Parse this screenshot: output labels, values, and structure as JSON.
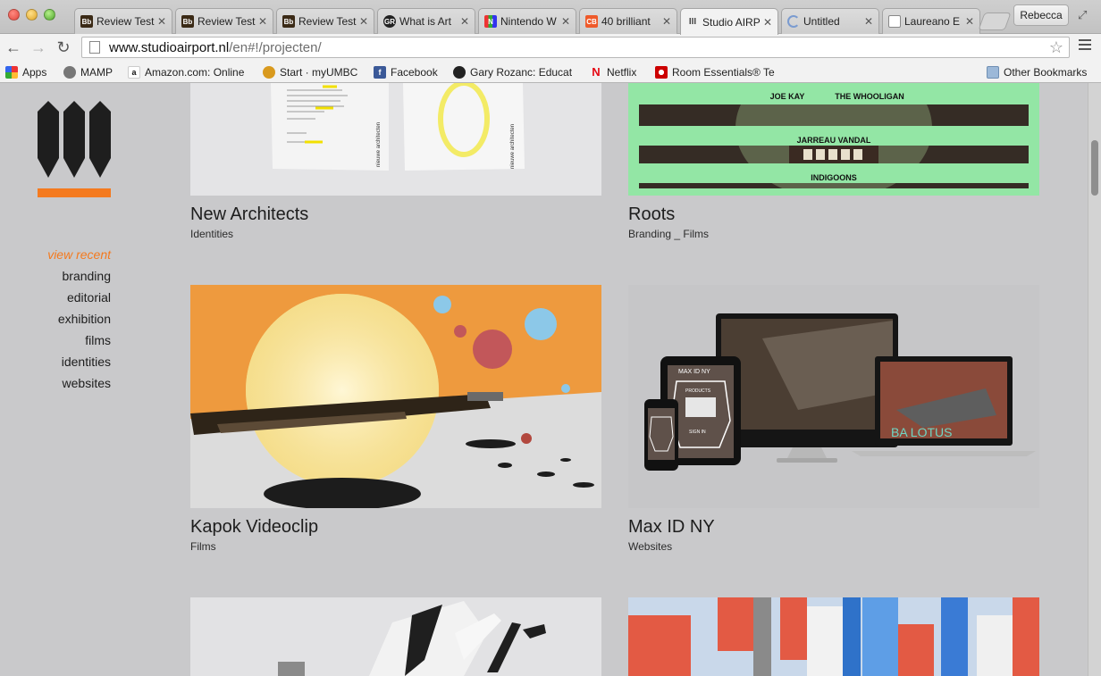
{
  "browser": {
    "tabs": [
      {
        "title": "Review Test",
        "favicon": "Bb"
      },
      {
        "title": "Review Test",
        "favicon": "Bb"
      },
      {
        "title": "Review Test",
        "favicon": "Bb"
      },
      {
        "title": "What is Art",
        "favicon": "GR"
      },
      {
        "title": "Nintendo W",
        "favicon": "N"
      },
      {
        "title": "40 brilliant",
        "favicon": "CB"
      },
      {
        "title": "Studio AIRP",
        "favicon": "III"
      },
      {
        "title": "Untitled",
        "favicon": "loading"
      },
      {
        "title": "Laureano E",
        "favicon": "doc"
      }
    ],
    "profile": "Rebecca",
    "url_host": "www.studioairport.nl",
    "url_path": "/en#!/projecten/",
    "bookmarks": [
      {
        "label": "Apps"
      },
      {
        "label": "MAMP"
      },
      {
        "label": "Amazon.com: Online"
      },
      {
        "label": "Start · myUMBC"
      },
      {
        "label": "Facebook"
      },
      {
        "label": "Gary Rozanc: Educat"
      },
      {
        "label": "Netflix"
      },
      {
        "label": "Room Essentials® Te"
      }
    ],
    "other_bookmarks": "Other Bookmarks"
  },
  "nav": {
    "current": "view recent",
    "items": [
      "branding",
      "editorial",
      "exhibition",
      "films",
      "identities",
      "websites"
    ]
  },
  "projects": [
    {
      "title": "New Architects",
      "category": "Identities"
    },
    {
      "title": "Roots",
      "category": "Branding _ Films"
    },
    {
      "title": "Kapok Videoclip",
      "category": "Films"
    },
    {
      "title": "Max ID NY",
      "category": "Websites"
    }
  ],
  "thumb_text": {
    "roots_lines": [
      "JOE KAY",
      "THE WHOOLIGAN",
      "JARREAU VANDAL",
      "INDIGOONS"
    ],
    "na_doc_label": "nieuwe architecten",
    "max_brand": "MAX ID NY",
    "max_products": "PRODUCTS",
    "max_signin": "SIGN IN",
    "max_lotus": "BA LOTUS"
  },
  "colors": {
    "accent": "#f47a1f",
    "page_bg": "#c9c9cb"
  }
}
